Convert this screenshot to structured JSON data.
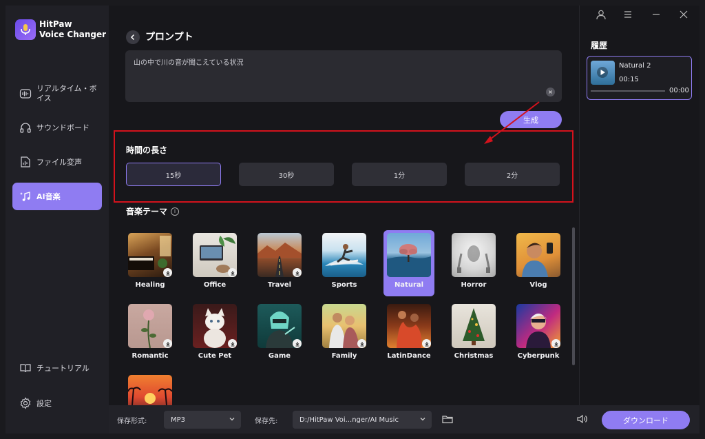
{
  "app": {
    "name_line1": "HitPaw",
    "name_line2": "Voice Changer"
  },
  "sidebar": {
    "items": [
      {
        "label": "リアルタイム・ボイス"
      },
      {
        "label": "サウンドボード"
      },
      {
        "label": "ファイル変声"
      },
      {
        "label": "AI音楽"
      },
      {
        "label": "チュートリアル"
      },
      {
        "label": "設定"
      }
    ],
    "active_index": 3
  },
  "prompt": {
    "title": "プロンプト",
    "text": "山の中で川の音が聞こえている状況",
    "generate_label": "生成"
  },
  "duration": {
    "label": "時間の長さ",
    "options": [
      "15秒",
      "30秒",
      "1分",
      "2分"
    ],
    "selected": "15秒"
  },
  "themes": {
    "label": "音楽テーマ",
    "selected": "Natural",
    "items": [
      "Healing",
      "Office",
      "Travel",
      "Sports",
      "Natural",
      "Horror",
      "Vlog",
      "Romantic",
      "Cute Pet",
      "Game",
      "Family",
      "LatinDance",
      "Christmas",
      "Cyberpunk"
    ]
  },
  "history": {
    "label": "履歴",
    "entries": [
      {
        "name": "Natural 2",
        "duration": "00:15",
        "position": "00:00"
      }
    ]
  },
  "bottom": {
    "format_label": "保存形式:",
    "format_value": "MP3",
    "path_label": "保存先:",
    "path_value": "D:/HitPaw Voi...nger/AI Music",
    "download_label": "ダウンロード"
  },
  "colors": {
    "accent": "#8f7cf2",
    "highlight_box": "#d4121c",
    "background": "#17171b"
  }
}
